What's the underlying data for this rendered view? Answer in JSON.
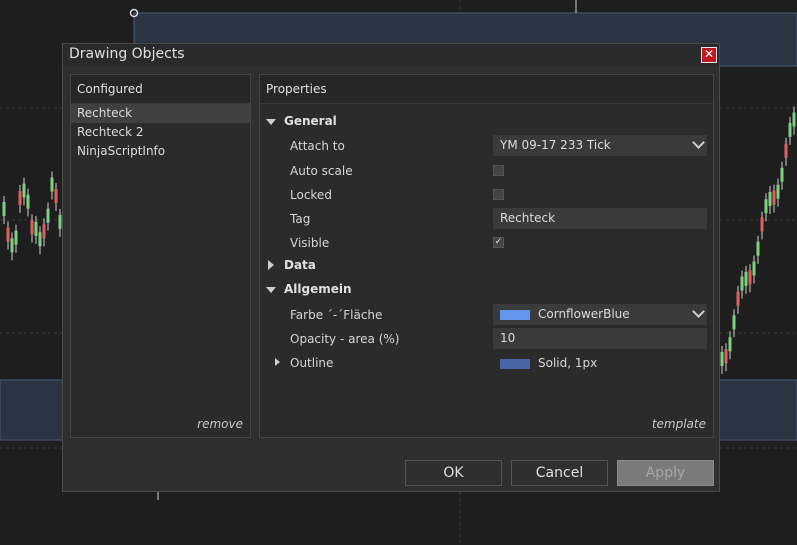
{
  "dialog": {
    "title": "Drawing Objects",
    "close_icon": "close-icon"
  },
  "configured": {
    "header": "Configured",
    "items": [
      "Rechteck",
      "Rechteck 2",
      "NinjaScriptInfo"
    ],
    "selected_index": 0,
    "remove_label": "remove"
  },
  "properties": {
    "header": "Properties",
    "template_label": "template",
    "general": {
      "label": "General",
      "attach_to_label": "Attach to",
      "attach_to_value": "YM 09-17 233 Tick",
      "auto_scale_label": "Auto scale",
      "auto_scale_checked": false,
      "locked_label": "Locked",
      "locked_checked": false,
      "tag_label": "Tag",
      "tag_value": "Rechteck",
      "visible_label": "Visible",
      "visible_checked": true
    },
    "data": {
      "label": "Data"
    },
    "allgemein": {
      "label": "Allgemein",
      "farbe_label": "Farbe ´-´Fläche",
      "farbe_value": "CornflowerBlue",
      "farbe_color": "#6495ed",
      "opacity_label": "Opacity - area (%)",
      "opacity_value": "10",
      "outline_label": "Outline",
      "outline_value": "Solid, 1px",
      "outline_color": "#4a64a8"
    }
  },
  "buttons": {
    "ok": "OK",
    "cancel": "Cancel",
    "apply": "Apply"
  },
  "colors": {
    "chart_bg": "#1e1e1e",
    "rect_fill": "#2b3442",
    "candle_up": "#7fd17f",
    "candle_down": "#e06060"
  }
}
